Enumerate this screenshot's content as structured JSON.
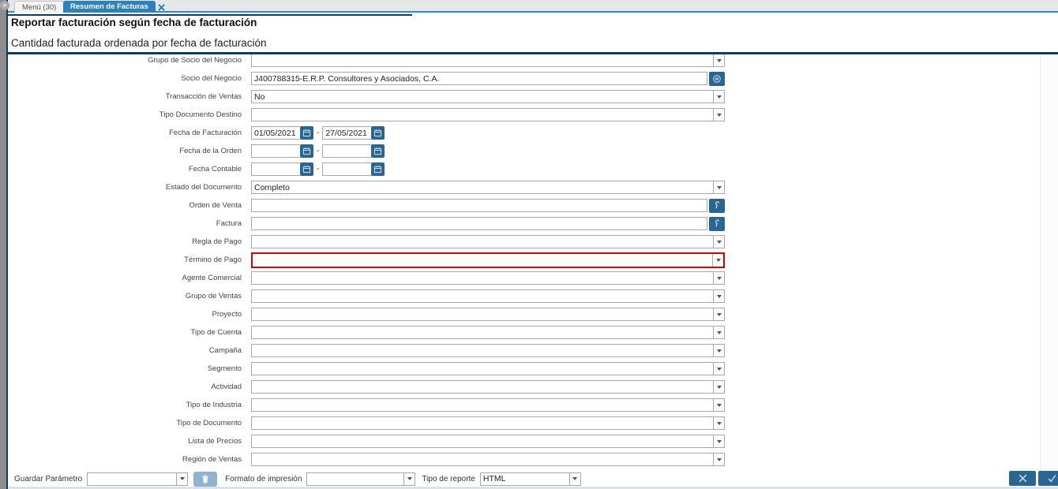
{
  "icons": {
    "panel_expand": "»"
  },
  "tabs": [
    {
      "label": "Menú (30)"
    },
    {
      "label": "Resumen de Facturas"
    }
  ],
  "header": {
    "title": "Reportar facturación según fecha de facturación",
    "subtitle": "Cantidad facturada ordenada por fecha de facturación"
  },
  "form": {
    "range_separator": "-",
    "fields": [
      {
        "label": "Grupo de Socio del Negocio",
        "type": "select",
        "value": ""
      },
      {
        "label": "Socio del Negocio",
        "type": "search",
        "value": "J400788315-E.R.P. Consultores y Asociados, C.A."
      },
      {
        "label": "Transacción de Ventas",
        "type": "select",
        "value": "No"
      },
      {
        "label": "Tipo Documento Destino",
        "type": "select",
        "value": ""
      },
      {
        "label": "Fecha de Facturación",
        "type": "daterange",
        "from": "01/05/2021",
        "to": "27/05/2021"
      },
      {
        "label": "Fecha de la Orden",
        "type": "daterange",
        "from": "",
        "to": ""
      },
      {
        "label": "Fecha Contable",
        "type": "daterange",
        "from": "",
        "to": ""
      },
      {
        "label": "Estado del Documento",
        "type": "select",
        "value": "Completo"
      },
      {
        "label": "Orden de Venta",
        "type": "search",
        "value": ""
      },
      {
        "label": "Factura",
        "type": "search",
        "value": ""
      },
      {
        "label": "Regla de Pago",
        "type": "select",
        "value": ""
      },
      {
        "label": "Término de Pago",
        "type": "select",
        "value": "",
        "error": true
      },
      {
        "label": "Agente Comercial",
        "type": "select",
        "value": ""
      },
      {
        "label": "Grupo de Ventas",
        "type": "select",
        "value": ""
      },
      {
        "label": "Proyecto",
        "type": "select",
        "value": ""
      },
      {
        "label": "Tipo de Cuenta",
        "type": "select",
        "value": ""
      },
      {
        "label": "Campaña",
        "type": "select",
        "value": ""
      },
      {
        "label": "Segmento",
        "type": "select",
        "value": ""
      },
      {
        "label": "Actividad",
        "type": "select",
        "value": ""
      },
      {
        "label": "Tipo de Industria",
        "type": "select",
        "value": ""
      },
      {
        "label": "Tipo de Documento",
        "type": "select",
        "value": ""
      },
      {
        "label": "Lista de Precios",
        "type": "select",
        "value": ""
      },
      {
        "label": "Región de Ventas",
        "type": "select",
        "value": ""
      }
    ]
  },
  "footer": {
    "save_parameter_label": "Guardar Parámetro",
    "save_parameter_value": "",
    "print_format_label": "Formato de impresión",
    "print_format_value": "",
    "report_type_label": "Tipo de reporte",
    "report_type_value": "HTML"
  },
  "colors": {
    "active_tab": "#2e81ba",
    "tabstrip_underline": "#2e8bc9",
    "panel_border": "#0d3c60",
    "action_button": "#2a6694",
    "trash_button": "#8fb3d3",
    "error_border": "#d40000"
  }
}
